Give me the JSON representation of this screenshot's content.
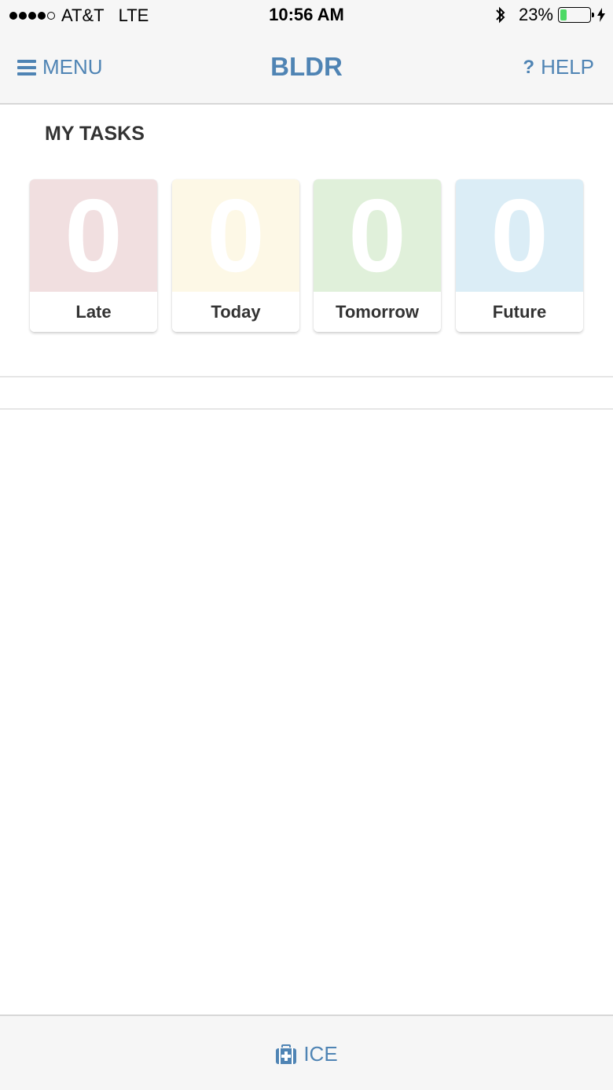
{
  "status_bar": {
    "carrier": "AT&T",
    "network": "LTE",
    "time": "10:56 AM",
    "battery": "23%",
    "battery_level": 0.23,
    "battery_color": "#4cd964",
    "signal_bars_filled": 4,
    "signal_bars_total": 5
  },
  "nav": {
    "menu_label": "MENU",
    "menu_icon": "hamburger-icon",
    "title": "BLDR",
    "help_label": "HELP",
    "help_icon": "question-icon",
    "help_symbol": "?"
  },
  "tasks": {
    "title": "MY TASKS",
    "cards": [
      {
        "label": "Late",
        "count": "0",
        "color": "#f1dfe0"
      },
      {
        "label": "Today",
        "count": "0",
        "color": "#fdf8e6"
      },
      {
        "label": "Tomorrow",
        "count": "0",
        "color": "#e0f0da"
      },
      {
        "label": "Future",
        "count": "0",
        "color": "#dbedf6"
      }
    ]
  },
  "bottom_bar": {
    "ice_label": "ICE",
    "ice_icon": "medkit-icon"
  },
  "colors": {
    "accent": "#4f84b4",
    "bar_background": "#f6f6f6",
    "text_dark": "#333333"
  }
}
